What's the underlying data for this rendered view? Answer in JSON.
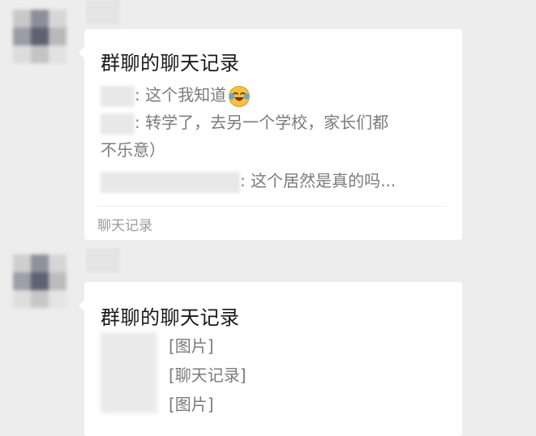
{
  "messages": [
    {
      "card_title": "群聊的聊天记录",
      "lines": [
        {
          "text": ": 这个我知道"
        },
        {
          "text": ": 转学了，去另一个学校，家长们都"
        },
        {
          "text": "不乐意）"
        },
        {
          "text": ": 这个居然是真的吗..."
        }
      ],
      "emoji": "laughing-crying-emoji",
      "footer_label": "聊天记录"
    },
    {
      "card_title": "群聊的聊天记录",
      "lines": [
        {
          "text": "[图片]"
        },
        {
          "text": "[聊天记录]"
        },
        {
          "text": "[图片]"
        }
      ]
    }
  ]
}
